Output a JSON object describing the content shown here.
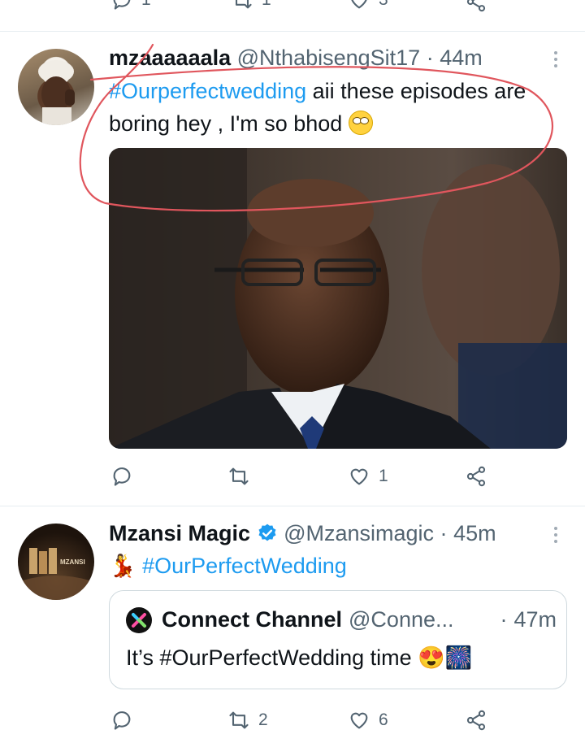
{
  "prev_tweet": {
    "reply_count": "1",
    "retweet_count": "1",
    "like_count": "3"
  },
  "tweet1": {
    "display_name": "mzaaaaaala",
    "handle": "@NthabisengSit17",
    "separator": "·",
    "time": "44m",
    "hashtag": "#Ourperfectwedding",
    "text_rest": " aii these episodes are boring hey , I'm so bhod",
    "emoji": "🙄",
    "like_count": "1",
    "image_icon": "photo-of-man-in-suit-and-glasses"
  },
  "tweet2": {
    "display_name": "Mzansi Magic",
    "verified": true,
    "handle": "@Mzansimagic",
    "separator": "·",
    "time": "45m",
    "dancer_emoji": "💃",
    "hashtag": "#OurPerfectWedding",
    "avatar_text": "MZANSI",
    "retweet_count": "2",
    "like_count": "6",
    "quote": {
      "display_name": "Connect Channel",
      "handle": "@Conne...",
      "separator": "·",
      "time": "47m",
      "text": "It’s #OurPerfectWedding time",
      "emojis": "😍🎆"
    }
  },
  "colors": {
    "accent": "#1d9bf0",
    "muted": "#536471",
    "annotation": "#e0565d"
  }
}
